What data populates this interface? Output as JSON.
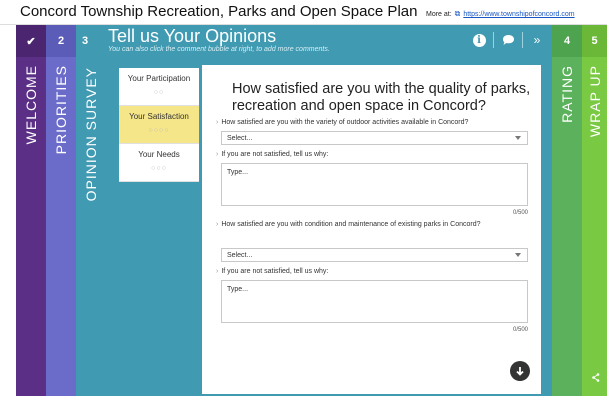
{
  "header": {
    "title": "Concord Township Recreation, Parks and Open Space Plan",
    "more_label": "More at:",
    "more_link": "https://www.townshipofconcord.com"
  },
  "steps": [
    {
      "num": "✔",
      "label": "WELCOME",
      "color": "#5b2f86"
    },
    {
      "num": "2",
      "label": "PRIORITIES",
      "color": "#6b6bc9"
    },
    {
      "num": "3",
      "label": "OPINION SURVEY",
      "color": "#3f9ab2"
    },
    {
      "num": "4",
      "label": "RATING",
      "color": "#5cb25c"
    },
    {
      "num": "5",
      "label": "WRAP UP",
      "color": "#7ac943"
    }
  ],
  "survey": {
    "title": "Tell us Your Opinions",
    "subtitle": "You can also click the comment bubble at right, to add more comments.",
    "icons": [
      "info-icon",
      "comment-icon",
      "next-icon"
    ]
  },
  "subnav": [
    {
      "label": "Your Participation",
      "dots": "○○",
      "active": false
    },
    {
      "label": "Your Satisfaction",
      "dots": "○○○○",
      "active": true
    },
    {
      "label": "Your Needs",
      "dots": "○○○",
      "active": false
    }
  ],
  "panel": {
    "question_title": "How satisfied are you with the quality of parks, recreation and open space in Concord?",
    "q1": "How satisfied are you with the variety of outdoor activities available in Concord?",
    "q1_value": "Select...",
    "q1_why": "If you are not satisfied, tell us why:",
    "q1_text_placeholder": "Type...",
    "q1_counter": "0/500",
    "q2": "How satisfied are you with condition and maintenance of existing parks in Concord?",
    "q2_value": "Select...",
    "q2_why": "If you are not satisfied, tell us why:",
    "q2_text_placeholder": "Type...",
    "q2_counter": "0/500"
  },
  "share_icon": "share-icon"
}
